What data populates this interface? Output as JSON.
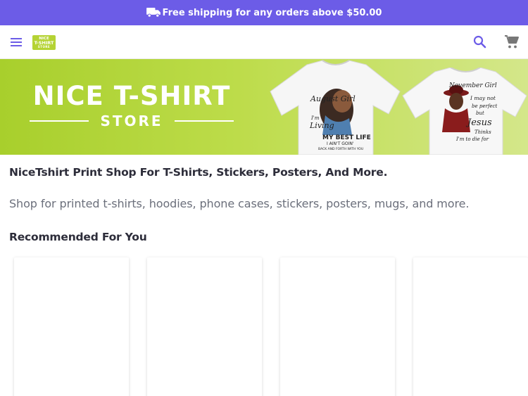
{
  "promo": {
    "icon": "truck-icon",
    "text": "Free shipping for any orders above $50.00",
    "background": "#6c5ce7"
  },
  "header": {
    "menu_icon": "hamburger-menu-icon",
    "logo": {
      "line1": "NICE",
      "line2": "T-SHIRT",
      "line3": "STORE",
      "color": "#b5d334"
    },
    "search_icon": "search-icon",
    "cart_icon": "cart-icon",
    "icon_color": "#6c5ce7"
  },
  "hero": {
    "title": "NICE T-SHIRT",
    "subtitle": "STORE",
    "shirt1": {
      "line1": "August Girl",
      "line2": "I'm",
      "line3": "Living",
      "line4": "MY BEST LIFE",
      "line5": "I AIN'T GOIN'",
      "line6": "BACK AND FORTH WITH YOU"
    },
    "shirt2": {
      "line1": "November Girl",
      "line2": "I may not",
      "line3": "be perfect",
      "line4": "but",
      "line5": "Jesus",
      "line6": "Thinks",
      "line7": "I'm to die for"
    }
  },
  "content": {
    "heading": "NiceTshirt Print Shop For T-Shirts, Stickers, Posters, And More.",
    "description": "Shop for printed t-shirts, hoodies, phone cases, stickers, posters, mugs, and more.",
    "recommended_title": "Recommended For You"
  }
}
